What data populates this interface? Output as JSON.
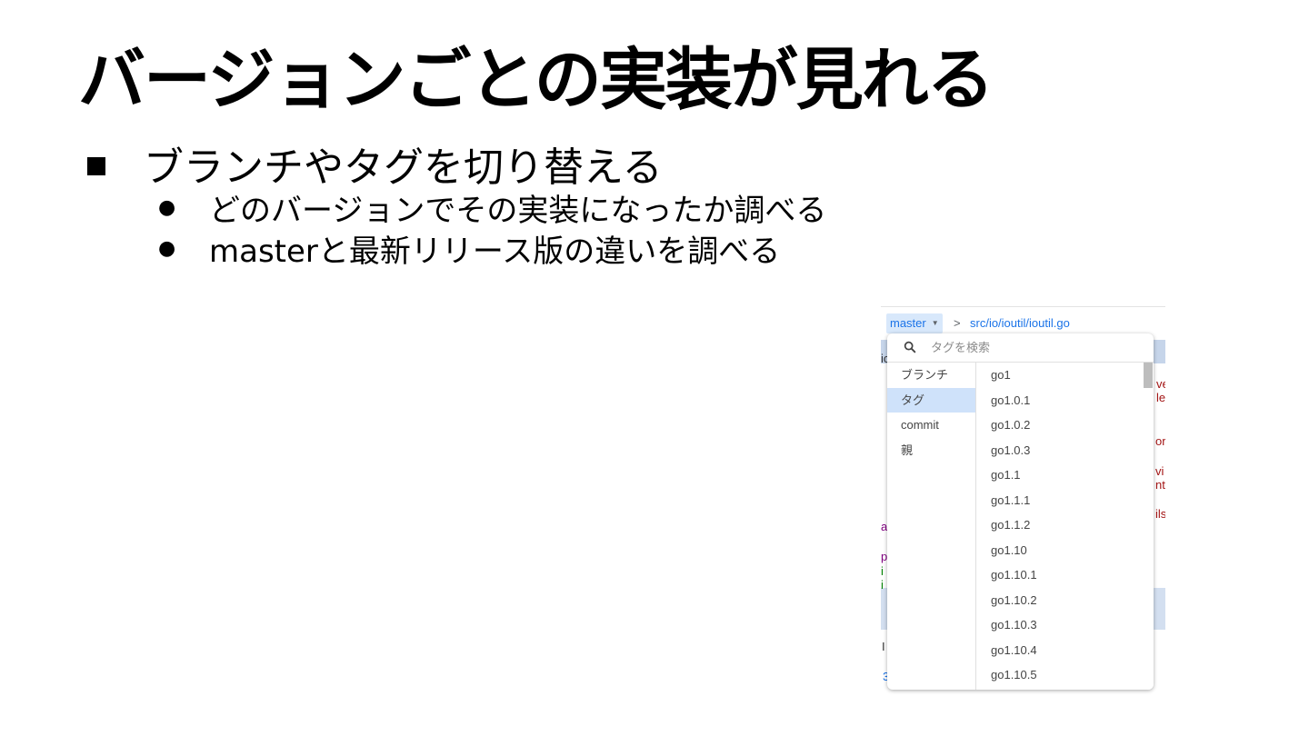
{
  "slide": {
    "title": "バージョンごとの実装が見れる",
    "bullet": "ブランチやタグを切り替える",
    "sub_bullets": [
      "どのバージョンでその実装になったか調べる",
      "masterと最新リリース版の違いを調べる"
    ]
  },
  "screenshot": {
    "branch_button": "master",
    "path_separator": ">",
    "path": "src/io/ioutil/ioutil.go",
    "search_placeholder": "タグを検索",
    "categories": [
      "ブランチ",
      "タグ",
      "commit",
      "親"
    ],
    "active_category": "タグ",
    "tags": [
      "go1",
      "go1.0.1",
      "go1.0.2",
      "go1.0.3",
      "go1.1",
      "go1.1.1",
      "go1.1.2",
      "go1.10",
      "go1.10.1",
      "go1.10.2",
      "go1.10.3",
      "go1.10.4",
      "go1.10.5"
    ],
    "colors": {
      "link": "#1a73e8",
      "branch_bg": "#d8e8fb",
      "active_bg": "#cfe2fa"
    }
  }
}
